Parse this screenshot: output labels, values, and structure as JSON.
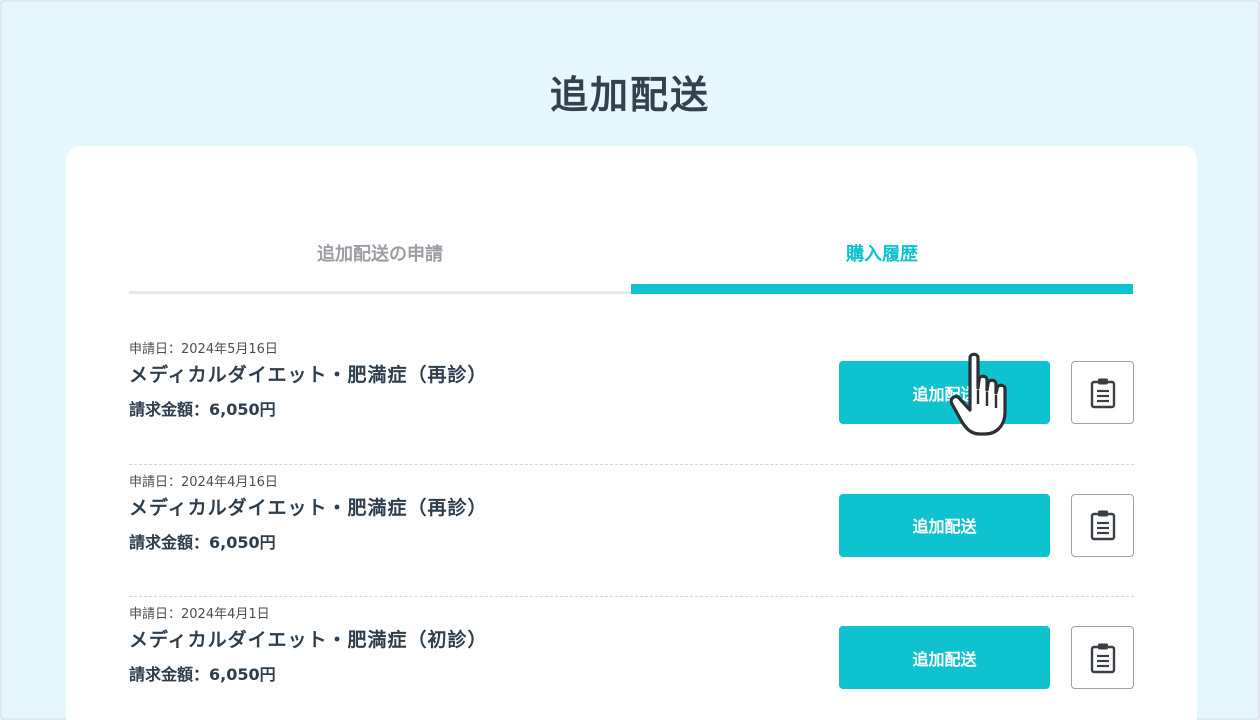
{
  "page": {
    "title": "追加配送"
  },
  "tabs": [
    {
      "label": "追加配送の申請",
      "active": false
    },
    {
      "label": "購入履歴",
      "active": true
    }
  ],
  "history": [
    {
      "date": "申請日：2024年5月16日",
      "title": "メディカルダイエット・肥満症（再診）",
      "price": "請求金額：6,050円",
      "button": "追加配送",
      "icon": "clipboard-icon"
    },
    {
      "date": "申請日：2024年4月16日",
      "title": "メディカルダイエット・肥満症（再診）",
      "price": "請求金額：6,050円",
      "button": "追加配送",
      "icon": "clipboard-icon"
    },
    {
      "date": "申請日：2024年4月1日",
      "title": "メディカルダイエット・肥満症（初診）",
      "price": "請求金額：6,050円",
      "button": "追加配送",
      "icon": "clipboard-icon"
    }
  ],
  "colors": {
    "accent": "#0fc2cf",
    "background": "#e5f7fd",
    "text": "#2f3e4c"
  },
  "cursor": {
    "icon": "hand-pointer-icon"
  }
}
